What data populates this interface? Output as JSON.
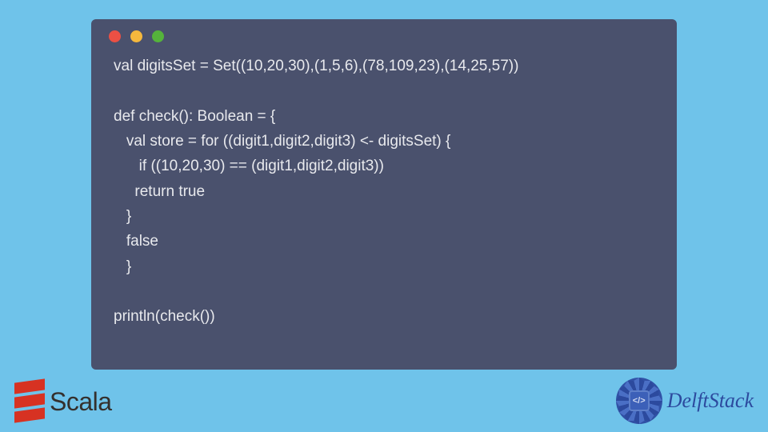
{
  "code": {
    "line1": "val digitsSet = Set((10,20,30),(1,5,6),(78,109,23),(14,25,57))",
    "line2": "",
    "line3": "def check(): Boolean = {",
    "line4": "  val store = for ((digit1,digit2,digit3) <- digitsSet) {",
    "line5": "     if ((10,20,30) == (digit1,digit2,digit3))",
    "line6": "   return true",
    "line7": "  }",
    "line8": "  false",
    "line9": "   }",
    "line10": "",
    "line11": "println(check())"
  },
  "logos": {
    "scala": "Scala",
    "delft": "DelftStack",
    "delft_icon_text": "</>"
  }
}
